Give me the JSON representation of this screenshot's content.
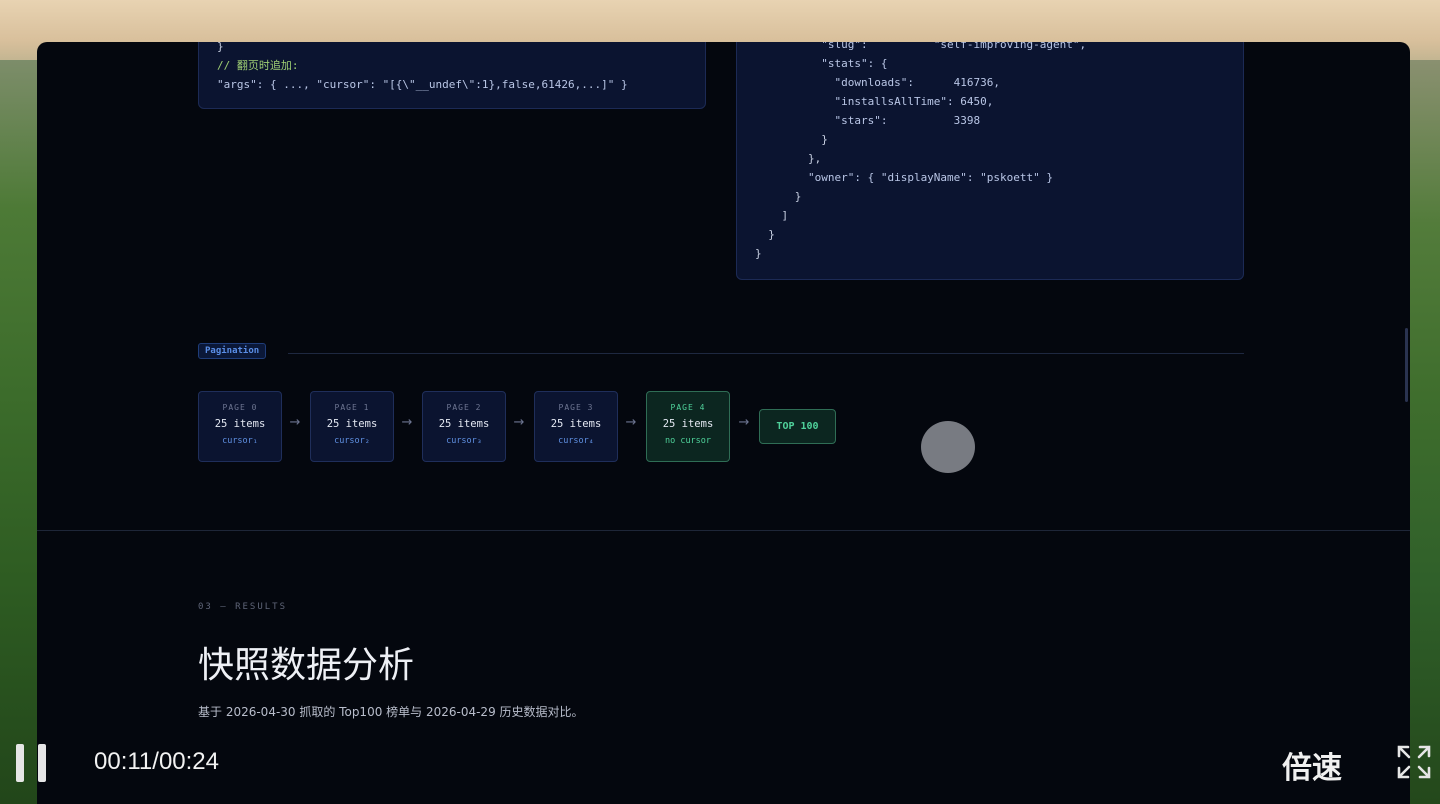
{
  "code_left": {
    "lines": [
      {
        "text": "}",
        "cls": "p"
      },
      {
        "text": "// 翻页时追加:",
        "cls": "c"
      },
      {
        "text": "\"args\": { ..., \"cursor\": \"[{\\\"__undef\\\":1},false,61426,...]\" }",
        "cls": "k"
      }
    ]
  },
  "code_right": {
    "lines": [
      {
        "text": "          \"slug\":          \"self-improving-agent\",",
        "cls": "k"
      },
      {
        "text": "          \"stats\": {",
        "cls": "k"
      },
      {
        "text": "            \"downloads\":      416736,",
        "cls": "k"
      },
      {
        "text": "            \"installsAllTime\": 6450,",
        "cls": "k"
      },
      {
        "text": "            \"stars\":          3398",
        "cls": "k"
      },
      {
        "text": "          }",
        "cls": "p"
      },
      {
        "text": "        },",
        "cls": "p"
      },
      {
        "text": "        \"owner\": { \"displayName\": \"pskoett\" }",
        "cls": "k"
      },
      {
        "text": "      }",
        "cls": "p"
      },
      {
        "text": "    ]",
        "cls": "p"
      },
      {
        "text": "  }",
        "cls": "p"
      },
      {
        "text": "}",
        "cls": "p"
      }
    ]
  },
  "pagination": {
    "tag": "Pagination",
    "pages": [
      {
        "label": "PAGE 0",
        "items": "25 items",
        "cursor": "cursor₁",
        "final": false
      },
      {
        "label": "PAGE 1",
        "items": "25 items",
        "cursor": "cursor₂",
        "final": false
      },
      {
        "label": "PAGE 2",
        "items": "25 items",
        "cursor": "cursor₃",
        "final": false
      },
      {
        "label": "PAGE 3",
        "items": "25 items",
        "cursor": "cursor₄",
        "final": false
      },
      {
        "label": "PAGE 4",
        "items": "25 items",
        "cursor": "no cursor",
        "final": true
      }
    ],
    "arrow": "→",
    "result_badge": "TOP 100"
  },
  "results": {
    "section_label": "03 — RESULTS",
    "title": "快照数据分析",
    "description": "基于 2026-04-30 抓取的 Top100 榜单与 2026-04-29 历史数据对比。"
  },
  "player": {
    "time": "00:11/00:24",
    "speed_label": "倍速",
    "icons": {
      "pause": "pause-icon",
      "fullscreen": "fullscreen-icon"
    }
  },
  "colors": {
    "accent_blue": "#5a8ee6",
    "accent_green": "#4fd19a",
    "background": "#04070e"
  }
}
